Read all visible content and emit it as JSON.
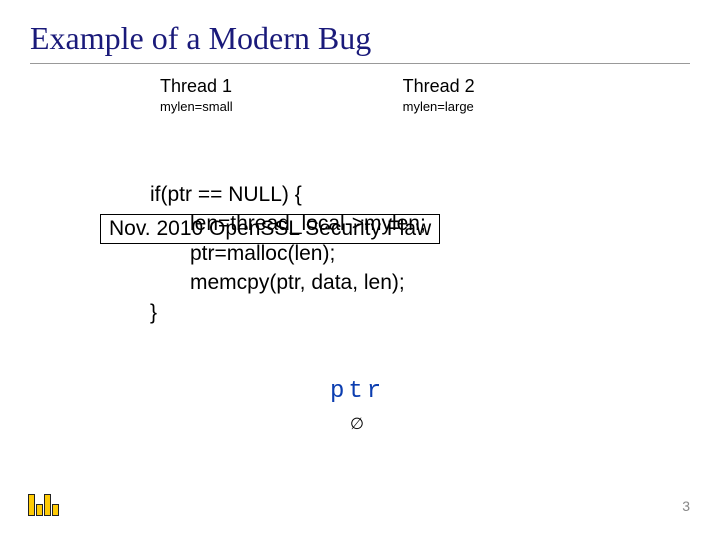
{
  "title": "Example of a Modern Bug",
  "threads": [
    {
      "label": "Thread 1",
      "sub": "mylen=small"
    },
    {
      "label": "Thread 2",
      "sub": "mylen=large"
    }
  ],
  "code": {
    "l1": "if(ptr == NULL) {",
    "l2": "len=thread_local->mylen;",
    "l3": "ptr=malloc(len);",
    "l4": "memcpy(ptr, data, len);",
    "l5": "}"
  },
  "overlay_text": "Nov. 2010 OpenSSL Security Flaw",
  "ptr_label": "ptr",
  "empty_set": "∅",
  "page_number": "3"
}
